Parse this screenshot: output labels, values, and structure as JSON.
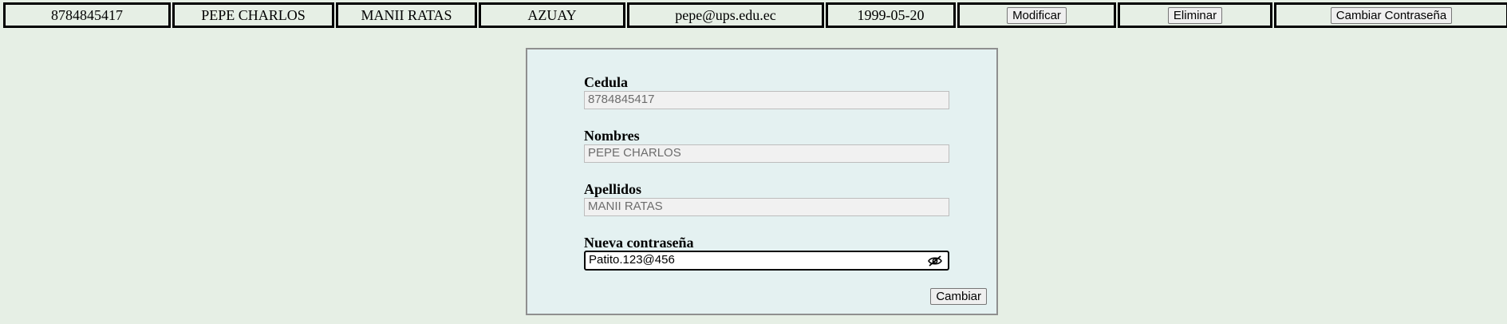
{
  "user_row": {
    "cedula": "8784845417",
    "nombres": "PEPE CHARLOS",
    "apellidos": "MANII RATAS",
    "provincia": "AZUAY",
    "correo": "pepe@ups.edu.ec",
    "fecha_nacimiento": "1999-05-20",
    "modificar_label": "Modificar",
    "eliminar_label": "Eliminar",
    "cambiar_contrasena_label": "Cambiar Contraseña"
  },
  "form": {
    "cedula_label": "Cedula",
    "cedula_value": "8784845417",
    "nombres_label": "Nombres",
    "nombres_value": "PEPE CHARLOS",
    "apellidos_label": "Apellidos",
    "apellidos_value": "MANII RATAS",
    "password_label": "Nueva contraseña",
    "password_value": "Patito.123@456",
    "password_toggle_icon": "eye-slash-icon",
    "submit_label": "Cambiar"
  },
  "colors": {
    "page_background": "#e6efe5",
    "form_background": "#e4f1f1"
  }
}
